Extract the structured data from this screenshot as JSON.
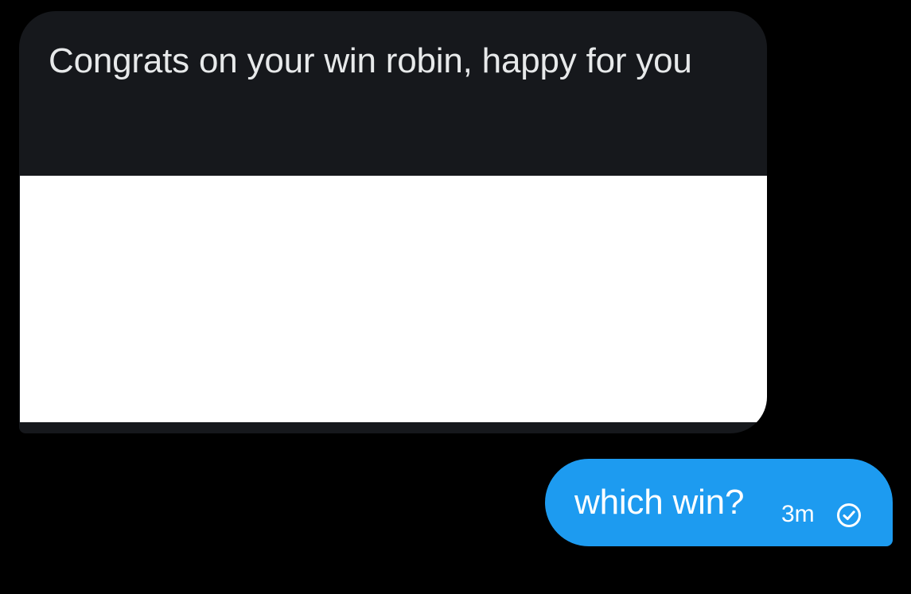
{
  "conversation": {
    "incoming_message": {
      "text": "Congrats on your win robin, happy for you",
      "attachment_color": "#ffffff"
    },
    "outgoing_message": {
      "text": "which win?",
      "timestamp": "3m",
      "status_icon": "check-circle-icon"
    }
  },
  "colors": {
    "background": "#000000",
    "incoming_bubble": "#16181c",
    "outgoing_bubble": "#1d9bf0",
    "text": "#e7e9ea"
  }
}
